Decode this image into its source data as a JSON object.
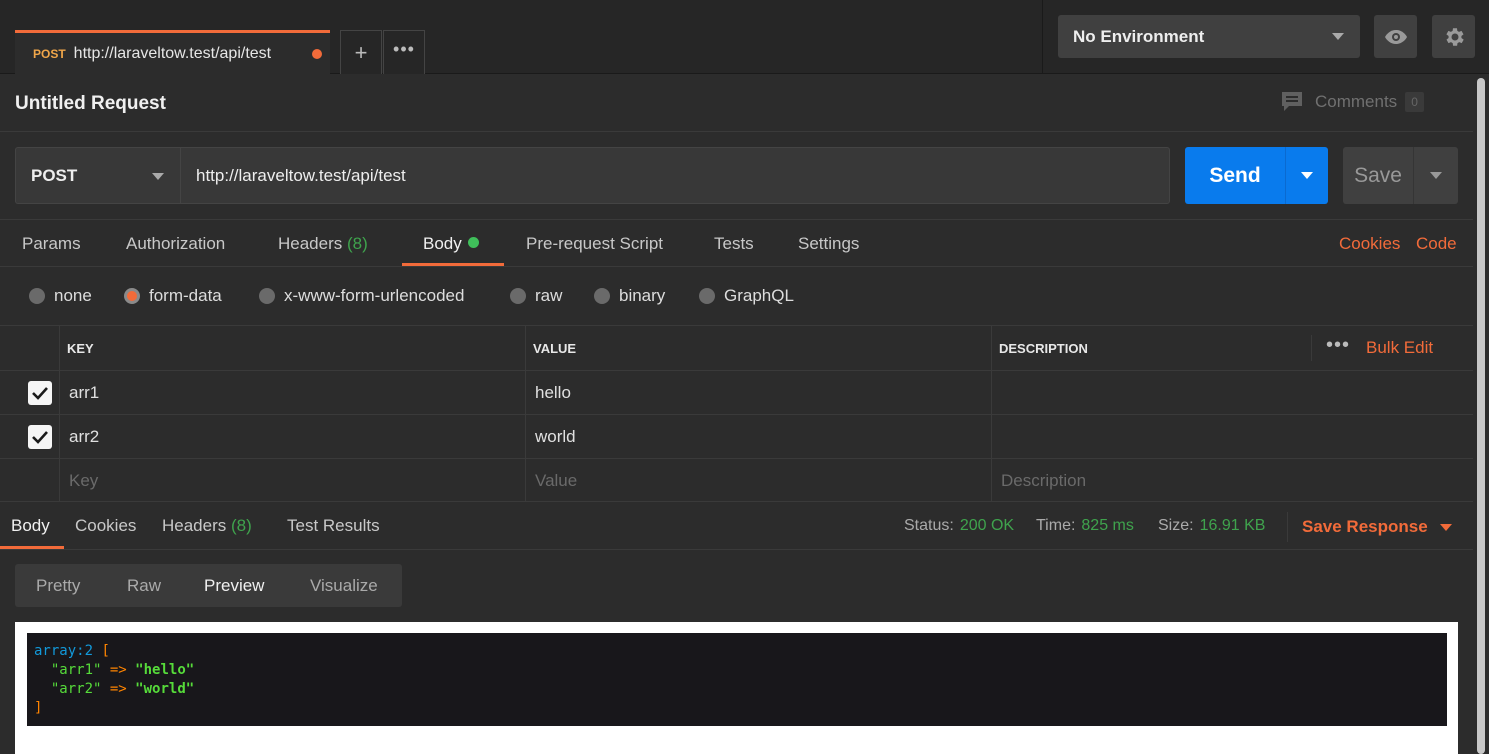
{
  "tab": {
    "method": "POST",
    "url": "http://laraveltow.test/api/test"
  },
  "environment": {
    "selected": "No Environment"
  },
  "request": {
    "title": "Untitled Request",
    "comments_label": "Comments",
    "comments_count": "0",
    "method": "POST",
    "url": "http://laraveltow.test/api/test",
    "send_label": "Send",
    "save_label": "Save"
  },
  "request_tabs": {
    "params": "Params",
    "authorization": "Authorization",
    "headers": "Headers",
    "headers_count": "(8)",
    "body": "Body",
    "prerequest": "Pre-request Script",
    "tests": "Tests",
    "settings": "Settings",
    "cookies": "Cookies",
    "code": "Code"
  },
  "body_types": [
    "none",
    "form-data",
    "x-www-form-urlencoded",
    "raw",
    "binary",
    "GraphQL"
  ],
  "body_type_selected": "form-data",
  "table": {
    "headers": {
      "key": "KEY",
      "value": "VALUE",
      "description": "DESCRIPTION"
    },
    "bulk_edit": "Bulk Edit",
    "rows": [
      {
        "key": "arr1",
        "value": "hello",
        "description": "",
        "checked": true
      },
      {
        "key": "arr2",
        "value": "world",
        "description": "",
        "checked": true
      }
    ],
    "placeholders": {
      "key": "Key",
      "value": "Value",
      "description": "Description"
    }
  },
  "response": {
    "tabs": {
      "body": "Body",
      "cookies": "Cookies",
      "headers": "Headers",
      "headers_count": "(8)",
      "tests": "Test Results"
    },
    "status_label": "Status:",
    "status": "200 OK",
    "time_label": "Time:",
    "time": "825 ms",
    "size_label": "Size:",
    "size": "16.91 KB",
    "save_response": "Save Response",
    "views": [
      "Pretty",
      "Raw",
      "Preview",
      "Visualize"
    ],
    "view_selected": "Preview",
    "dump": {
      "type": "array:2",
      "open": "[",
      "close": "]",
      "arrow": "=>",
      "entries": [
        {
          "key": "\"arr1\"",
          "value": "\"hello\""
        },
        {
          "key": "\"arr2\"",
          "value": "\"world\""
        }
      ]
    }
  },
  "colors": {
    "accent": "#f26b3a",
    "send": "#097bed",
    "success": "#3fa34d"
  }
}
